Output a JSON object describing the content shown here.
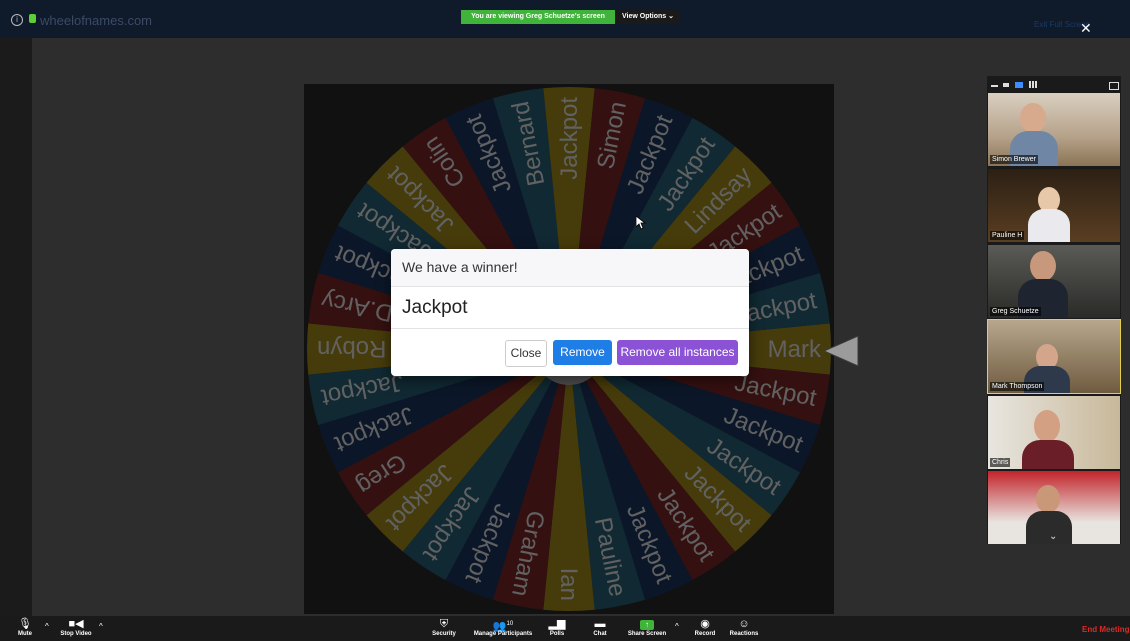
{
  "browser": {
    "url": "wheelofnames.com"
  },
  "zoom_bar": {
    "banner": "You are viewing Greg Schuetze's screen",
    "view_options": "View Options ⌄",
    "exit_fullscreen": "Exit Full Screen"
  },
  "wheel": {
    "colors": [
      "#b79c1c",
      "#8c2a2a",
      "#1f3d6a",
      "#2a6c86",
      "#b79c1c",
      "#8c2a2a",
      "#1f3d6a",
      "#2a6c86"
    ],
    "segments": [
      "Mark",
      "Jackpot",
      "Jackpot",
      "Jackpot",
      "Jackpot",
      "Jackpot",
      "Jackpot",
      "Pauline",
      "Ian",
      "Graham",
      "Jackpot",
      "Jackpot",
      "Jackpot",
      "Greg",
      "Jackpot",
      "Jackpot",
      "Robyn",
      "D.Arcy",
      "Jackpot",
      "Jackpot",
      "Jackpot",
      "Colin",
      "Jackpot",
      "Bernard",
      "Jackpot",
      "Simon",
      "Jackpot",
      "Jackpot",
      "Lindsay",
      "Jackpot",
      "Jackpot",
      "Jackpot"
    ]
  },
  "modal": {
    "title": "We have a winner!",
    "winner": "Jackpot",
    "close": "Close",
    "remove": "Remove",
    "remove_all": "Remove all instances"
  },
  "participants": [
    {
      "name": "Simon Brewer"
    },
    {
      "name": "Pauline H"
    },
    {
      "name": "Greg Schuetze"
    },
    {
      "name": "Mark Thompson"
    },
    {
      "name": "Chris"
    },
    {
      "name": ""
    }
  ],
  "toolbar": {
    "mute": "Mute",
    "stop_video": "Stop Video",
    "security": "Security",
    "manage_participants": "Manage Participants",
    "participant_count": "10",
    "polls": "Polls",
    "chat": "Chat",
    "share_screen": "Share Screen",
    "record": "Record",
    "reactions": "Reactions",
    "end_meeting": "End Meeting"
  }
}
